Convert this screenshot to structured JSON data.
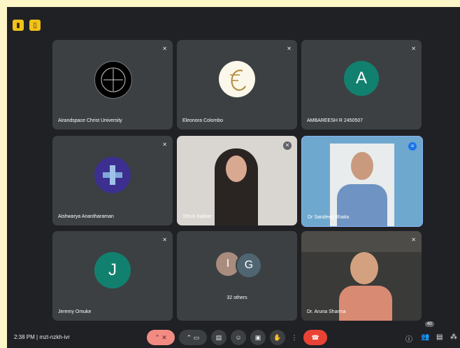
{
  "top_icons": [
    "note-icon",
    "door-icon"
  ],
  "tiles": [
    {
      "name": "Airandspace Christ University",
      "muted": true
    },
    {
      "name": "Eleonora Colombo",
      "muted": true
    },
    {
      "name": "AMBAREESH R 2450507",
      "muted": true,
      "initial": "A"
    },
    {
      "name": "Aishwarya Anantharaman",
      "muted": true
    },
    {
      "name": "Shruti Kakkar",
      "muted": true
    },
    {
      "name": "Dr Sandeep Bhatia",
      "speaking": true
    },
    {
      "name": "Jeremy Omuke",
      "muted": true,
      "initial": "J"
    },
    {
      "name": "32 others",
      "initials": [
        "I",
        "G"
      ]
    },
    {
      "name": "Dr. Aruna Sharma",
      "muted": true
    }
  ],
  "bottom": {
    "time": "2:38 PM",
    "separator": "|",
    "meeting_code": "mzt-nzkh-ivr",
    "participants_count": "40"
  },
  "colors": {
    "accent": "#8ab4f8",
    "end": "#ea4335",
    "muted_red": "#f28b82"
  }
}
